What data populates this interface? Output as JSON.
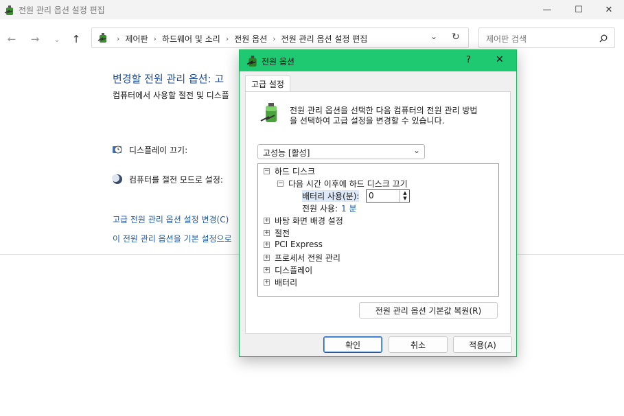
{
  "window": {
    "title": "전원 관리 옵션 설정 편집",
    "minimize": "—",
    "maximize": "☐",
    "close": "✕"
  },
  "address": {
    "crumbs": [
      "제어판",
      "하드웨어 및 소리",
      "전원 옵션",
      "전원 관리 옵션 설정 편집"
    ],
    "search_placeholder": "제어판 검색"
  },
  "page": {
    "heading": "변경할 전원 관리 옵션: 고",
    "desc": "컴퓨터에서 사용할 절전 및 디스플",
    "display_off_label": "디스플레이 끄기:",
    "sleep_label": "컴퓨터를 절전 모드로 설정:",
    "link_advanced": "고급 전원 관리 옵션 설정 변경(C)",
    "link_restore": "이 전원 관리 옵션을 기본 설정으로"
  },
  "dialog": {
    "title": "전원 옵션",
    "help": "?",
    "close": "✕",
    "tab": "고급 설정",
    "description_line1": "전원 관리 옵션을 선택한 다음 컴퓨터의 전원 관리 방법",
    "description_line2": "을 선택하여 고급 설정을 변경할 수 있습니다.",
    "plan_selected": "고성능 [활성]",
    "tree": {
      "hard_disk": "하드 디스크",
      "turn_off_after": "다음 시간 이후에 하드 디스크 끄기",
      "on_battery_label": "배터리 사용(분):",
      "on_battery_value": "0",
      "plugged_in_label": "전원 사용:",
      "plugged_in_value": "1 분",
      "items": [
        "바탕 화면 배경 설정",
        "절전",
        "PCI Express",
        "프로세서 전원 관리",
        "디스플레이",
        "배터리"
      ]
    },
    "restore_button": "전원 관리 옵션 기본값 복원(R)",
    "ok": "확인",
    "cancel": "취소",
    "apply": "적용(A)"
  },
  "colors": {
    "accent": "#1ec971",
    "link": "#1f5ba8"
  }
}
